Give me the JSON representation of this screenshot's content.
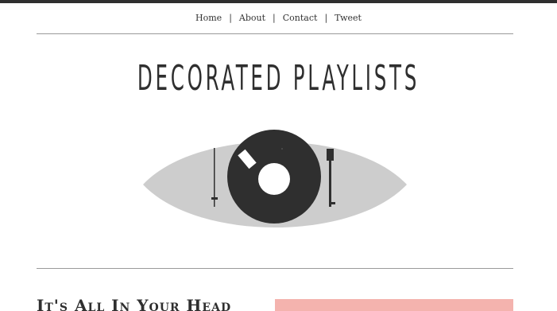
{
  "nav": {
    "items": [
      "Home",
      "About",
      "Contact",
      "Tweet"
    ],
    "separator": "|"
  },
  "site": {
    "title": "DECORATED PLAYLISTS"
  },
  "post": {
    "title": "It's All In Your Head"
  },
  "colors": {
    "dark": "#2f2f2f",
    "eye_gray": "#cdcdcd",
    "rule": "#9a9a9a",
    "accent_pink": "#f4b3ae"
  },
  "logo": {
    "icon": "turntable-eye-icon"
  }
}
